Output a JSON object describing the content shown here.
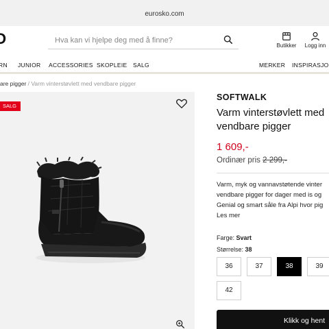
{
  "browser": {
    "url": "eurosko.com"
  },
  "header": {
    "logo": "O",
    "search_placeholder": "Hva kan vi hjelpe deg med å finne?",
    "stores_label": "Butikker",
    "login_label": "Logg inn"
  },
  "nav": {
    "items": [
      "RN",
      "JUNIOR",
      "ACCESSORIES",
      "SKOPLEIE",
      "SALG",
      "MERKER",
      "INSPIRASJON"
    ]
  },
  "breadcrumb": {
    "parent": "are pigger",
    "separator": " / ",
    "current": "Varm vinterstøvlett med vendbare pigger"
  },
  "product": {
    "sale_badge": "SALG",
    "brand": "SOFTWALK",
    "title": "Varm vinterstøvlett med vendbare pigger",
    "price": "1 609,-",
    "ordinary_label": "Ordinær pris ",
    "ordinary_price": "2 299,-",
    "description_lines": [
      "Varm, myk og vannavstøtende vinter",
      "vendbare pigger for dager med is og",
      "Genial og smart såle fra Alpi hvor pig",
      "Les mer"
    ],
    "color_label": "Farge: ",
    "color_value": "Svart",
    "size_label": "Størrelse: ",
    "size_value": "38",
    "sizes": [
      "36",
      "37",
      "38",
      "39",
      "42"
    ],
    "selected_size": "38",
    "cta_label": "Klikk og hent"
  },
  "colors": {
    "sale_red": "#e2001a",
    "price_red": "#d0021b",
    "nav_underline": "#e8e4db"
  }
}
